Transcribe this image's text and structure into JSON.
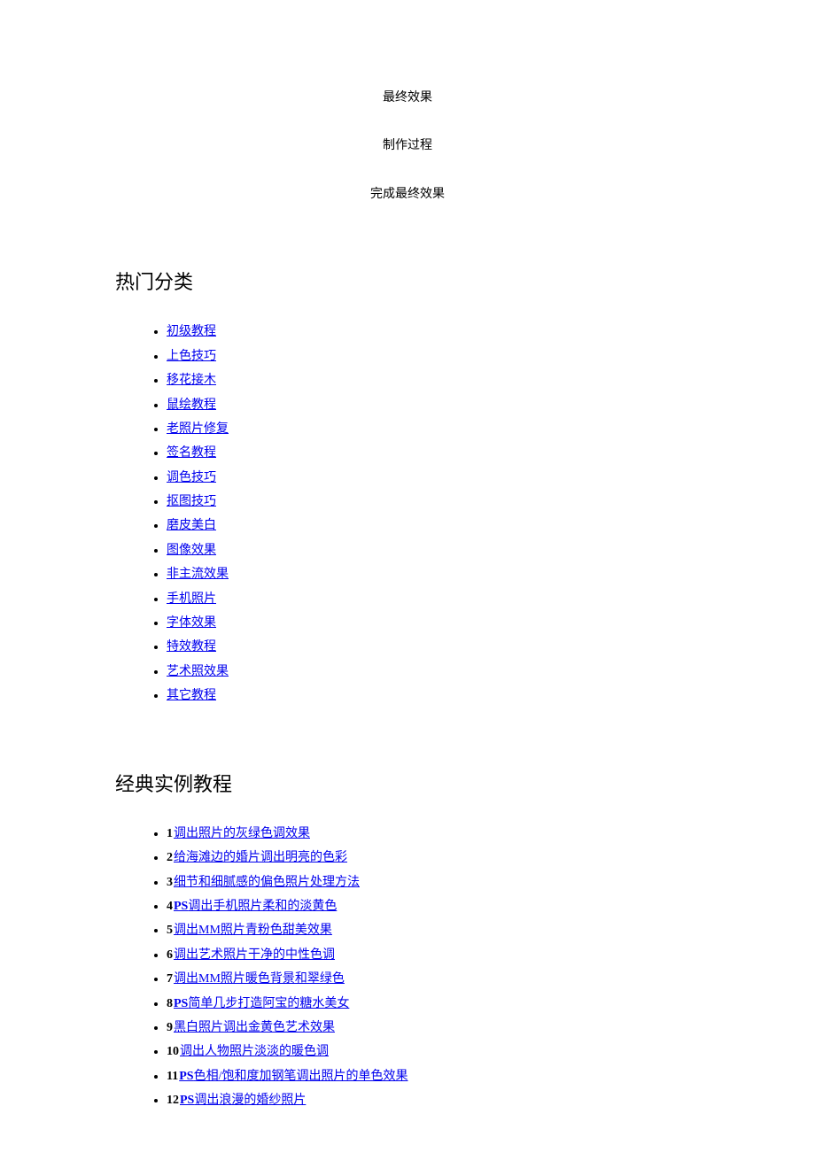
{
  "intro": {
    "line1": "最终效果",
    "line2": "制作过程",
    "line3": "完成最终效果"
  },
  "sections": {
    "categories_heading": "热门分类",
    "tutorials_heading": "经典实例教程"
  },
  "categories": [
    {
      "label": "初级教程"
    },
    {
      "label": "上色技巧"
    },
    {
      "label": "移花接木"
    },
    {
      "label": "鼠绘教程"
    },
    {
      "label": "老照片修复"
    },
    {
      "label": "签名教程"
    },
    {
      "label": "调色技巧"
    },
    {
      "label": "抠图技巧"
    },
    {
      "label": "磨皮美白"
    },
    {
      "label": "图像效果"
    },
    {
      "label": "非主流效果"
    },
    {
      "label": "手机照片"
    },
    {
      "label": "字体效果"
    },
    {
      "label": "特效教程"
    },
    {
      "label": "艺术照效果"
    },
    {
      "label": "其它教程"
    }
  ],
  "tutorials": [
    {
      "n": "1",
      "ps": false,
      "text": "调出照片的灰绿色调效果"
    },
    {
      "n": "2",
      "ps": false,
      "text": "给海滩边的婚片调出明亮的色彩"
    },
    {
      "n": "3",
      "ps": false,
      "text": "细节和细腻感的偏色照片处理方法"
    },
    {
      "n": "4",
      "ps": true,
      "text": "调出手机照片柔和的淡黄色"
    },
    {
      "n": "5",
      "ps": false,
      "text": "调出MM照片青粉色甜美效果"
    },
    {
      "n": "6",
      "ps": false,
      "text": "调出艺术照片干净的中性色调"
    },
    {
      "n": "7",
      "ps": false,
      "text": "调出MM照片暖色背景和翠绿色"
    },
    {
      "n": "8",
      "ps": true,
      "text": "简单几步打造阿宝的糖水美女"
    },
    {
      "n": "9",
      "ps": false,
      "text": "黑白照片调出金黄色艺术效果"
    },
    {
      "n": "10",
      "ps": false,
      "text": "调出人物照片淡淡的暖色调"
    },
    {
      "n": "11",
      "ps": true,
      "text": "色相/饱和度加钢笔调出照片的单色效果"
    },
    {
      "n": "12",
      "ps": true,
      "text": "调出浪漫的婚纱照片"
    }
  ],
  "ps_label": "PS"
}
